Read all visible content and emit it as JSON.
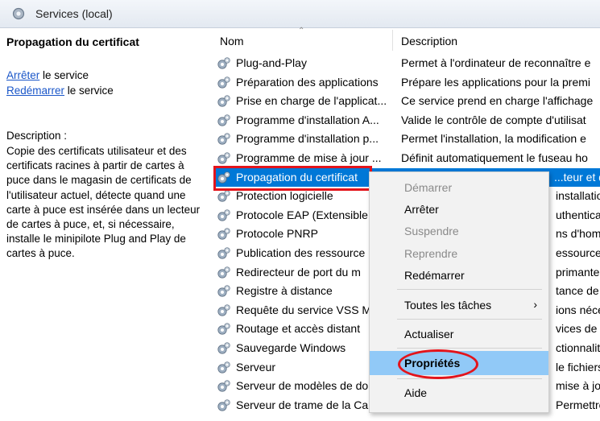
{
  "window": {
    "title": "Services (local)"
  },
  "left_panel": {
    "service_name": "Propagation du certificat",
    "actions": [
      {
        "link": "Arrêter",
        "suffix": " le service"
      },
      {
        "link": "Redémarrer",
        "suffix": " le service"
      }
    ],
    "description_label": "Description :",
    "description_text": "Copie des certificats utilisateur et des certificats racines à partir de cartes à puce dans le magasin de certificats de l'utilisateur actuel, détecte quand une carte à puce est insérée dans un lecteur de cartes à puce, et, si nécessaire, installe le minipilote Plug and Play de cartes à puce."
  },
  "columns": {
    "name": "Nom",
    "description": "Description"
  },
  "services": [
    {
      "name": "Plug-and-Play",
      "description": "Permet à l'ordinateur de reconnaître e"
    },
    {
      "name": "Préparation des applications",
      "description": "Prépare les applications pour la premi"
    },
    {
      "name": "Prise en charge de l'applicat...",
      "description": "Ce service prend en charge l'affichage"
    },
    {
      "name": "Programme d'installation A...",
      "description": "Valide le contrôle de compte d'utilisat"
    },
    {
      "name": "Programme d'installation p...",
      "description": "Permet l'installation, la modification e"
    },
    {
      "name": "Programme de mise à jour ...",
      "description": "Définit automatiquement le fuseau ho"
    },
    {
      "name": "Propagation du certificat",
      "description": "...teur et des"
    },
    {
      "name": "Protection logicielle",
      "description": "installatio"
    },
    {
      "name": "Protocole EAP (Extensible",
      "description": "uthenticat"
    },
    {
      "name": "Protocole PNRP",
      "description": "ns d'homo"
    },
    {
      "name": "Publication des ressource",
      "description": "essources"
    },
    {
      "name": "Redirecteur de port du m",
      "description": "primantes"
    },
    {
      "name": "Registre à distance",
      "description": "tance de r"
    },
    {
      "name": "Requête du service VSS M",
      "description": "ions néce"
    },
    {
      "name": "Routage et accès distant",
      "description": "vices de r"
    },
    {
      "name": "Sauvegarde Windows",
      "description": "ctionnalit"
    },
    {
      "name": "Serveur",
      "description": "le fichiers"
    },
    {
      "name": "Serveur de modèles de do",
      "description": "mise à jou"
    },
    {
      "name": "Serveur de trame de la Cam...",
      "description": "Permettre à plusieurs clients d'accéde"
    }
  ],
  "context_menu": {
    "items": [
      {
        "label": "Démarrer",
        "disabled": true
      },
      {
        "label": "Arrêter",
        "disabled": false
      },
      {
        "label": "Suspendre",
        "disabled": true
      },
      {
        "label": "Reprendre",
        "disabled": true
      },
      {
        "label": "Redémarrer",
        "disabled": false
      },
      {
        "label": "Toutes les tâches",
        "submenu": true
      },
      {
        "label": "Actualiser",
        "disabled": false
      },
      {
        "label": "Propriétés",
        "highlighted": true
      },
      {
        "label": "Aide",
        "disabled": false
      }
    ],
    "submenu_arrow": "›"
  },
  "colors": {
    "selection": "#0078d7",
    "menu_highlight": "#91c9f7",
    "annotation_red": "#e3141b",
    "link": "#1a56c8"
  },
  "icons": {
    "service": "gear-icon",
    "title": "services-gear-icon"
  }
}
